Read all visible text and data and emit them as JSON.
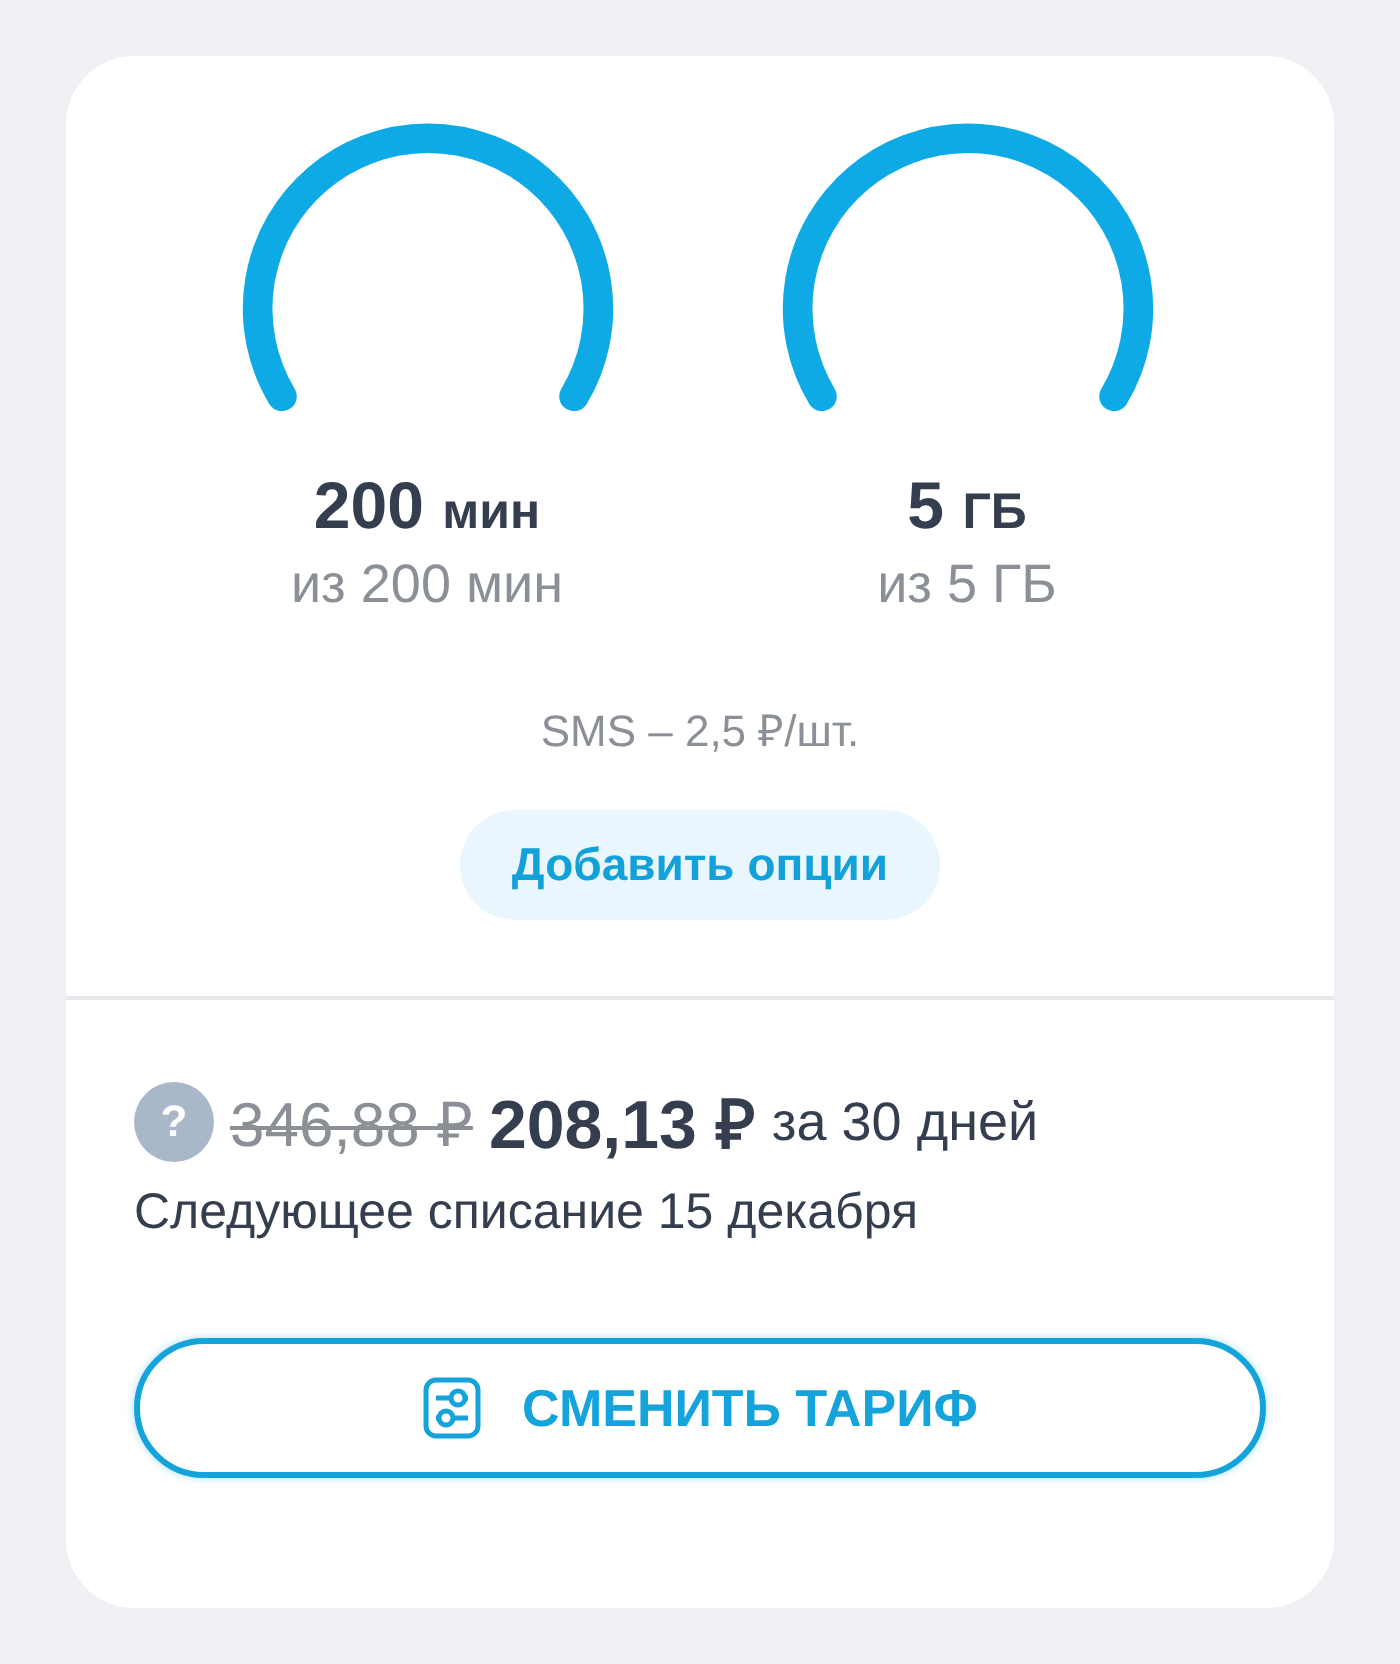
{
  "gauges": [
    {
      "amount": "200",
      "unit": "мин",
      "total": "из 200 мин"
    },
    {
      "amount": "5",
      "unit": "ГБ",
      "total": "из 5 ГБ"
    }
  ],
  "sms_rate": "SMS – 2,5 ₽/шт.",
  "add_options_button": "Добавить опции",
  "price": {
    "old": "346,88 ₽",
    "current": "208,13 ₽",
    "period": "за 30 дней",
    "help_icon": "?"
  },
  "next_charge": "Следующее списание 15 декабря",
  "change_tariff_button": "СМЕНИТЬ ТАРИФ"
}
